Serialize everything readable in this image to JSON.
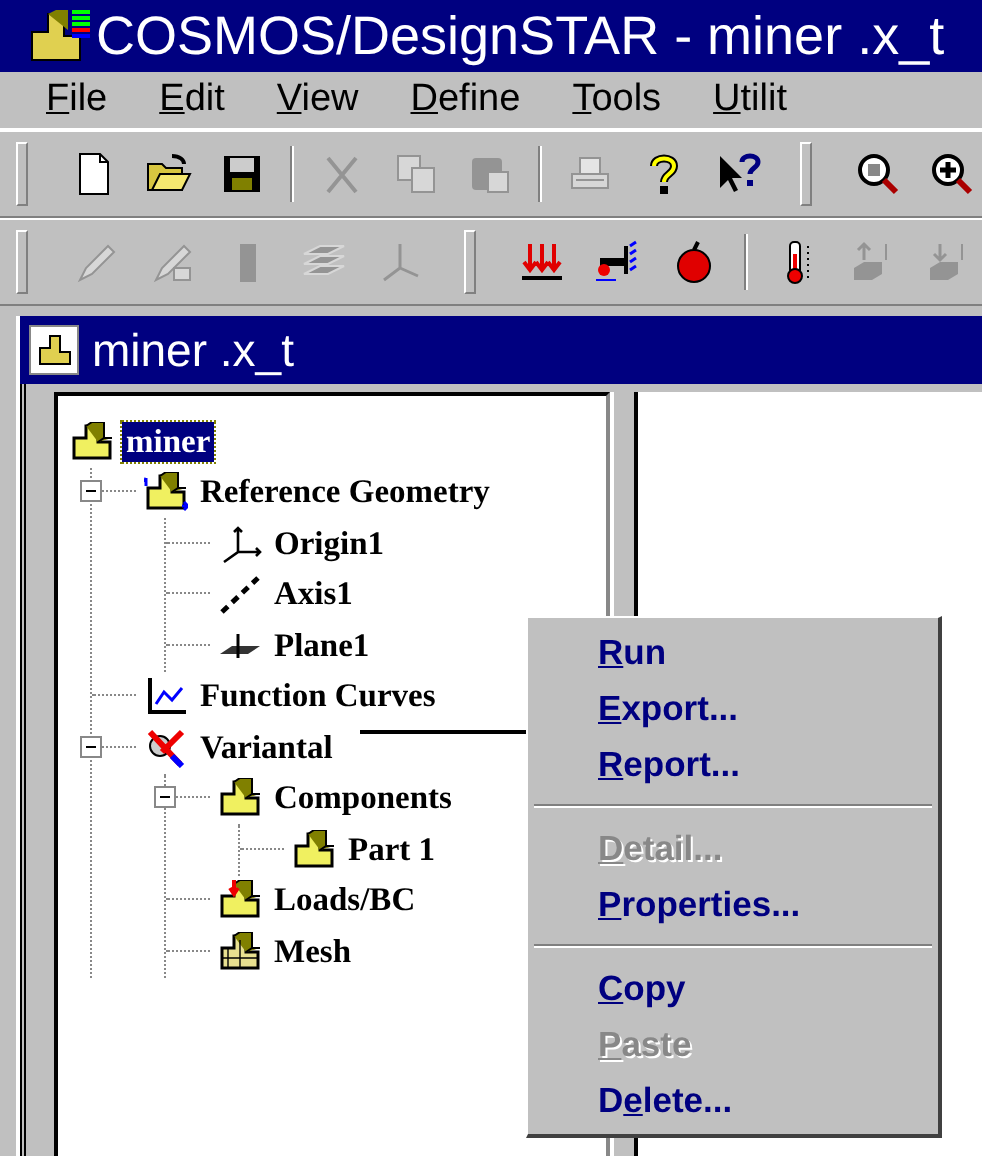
{
  "window": {
    "title": "COSMOS/DesignSTAR - miner .x_t"
  },
  "menu_bar": [
    {
      "key": "F",
      "rest": "ile"
    },
    {
      "key": "E",
      "rest": "dit"
    },
    {
      "key": "V",
      "rest": "iew"
    },
    {
      "key": "D",
      "rest": "efine"
    },
    {
      "key": "T",
      "rest": "ools"
    },
    {
      "key": "U",
      "rest": "tilit"
    }
  ],
  "toolbars": [
    {
      "items": [
        {
          "kind": "new-file",
          "disabled": false
        },
        {
          "kind": "open-folder",
          "disabled": false
        },
        {
          "kind": "save",
          "disabled": false
        },
        {
          "kind": "separator"
        },
        {
          "kind": "cut",
          "disabled": true
        },
        {
          "kind": "copy",
          "disabled": true
        },
        {
          "kind": "paste",
          "disabled": true
        },
        {
          "kind": "separator"
        },
        {
          "kind": "print",
          "disabled": true
        },
        {
          "kind": "help",
          "disabled": false
        },
        {
          "kind": "context-help",
          "disabled": false
        },
        {
          "kind": "grip"
        },
        {
          "kind": "zoom-box",
          "disabled": false
        },
        {
          "kind": "zoom-in",
          "disabled": false
        }
      ]
    },
    {
      "items": [
        {
          "kind": "pen",
          "disabled": true
        },
        {
          "kind": "pen-edit",
          "disabled": true
        },
        {
          "kind": "bar",
          "disabled": true
        },
        {
          "kind": "layers",
          "disabled": true
        },
        {
          "kind": "axes",
          "disabled": true
        },
        {
          "kind": "grip"
        },
        {
          "kind": "loads",
          "disabled": false
        },
        {
          "kind": "restraint",
          "disabled": false
        },
        {
          "kind": "gravity",
          "disabled": false
        },
        {
          "kind": "separator"
        },
        {
          "kind": "thermometer",
          "disabled": false
        },
        {
          "kind": "heat-up",
          "disabled": true
        },
        {
          "kind": "heat-down",
          "disabled": true
        }
      ]
    }
  ],
  "document": {
    "title": "miner .x_t",
    "tree": [
      {
        "label": "miner",
        "kind": "part",
        "selected": true,
        "children": [
          {
            "label": "Reference Geometry",
            "kind": "ref-geometry",
            "selected": false,
            "expanded": true,
            "children": [
              {
                "label": "Origin1",
                "kind": "origin",
                "selected": false
              },
              {
                "label": "Axis1",
                "kind": "axis",
                "selected": false
              },
              {
                "label": "Plane1",
                "kind": "plane",
                "selected": false
              }
            ]
          },
          {
            "label": "Function Curves",
            "kind": "curves",
            "selected": false
          },
          {
            "label": "Variantal",
            "kind": "study",
            "selected": false,
            "expanded": true,
            "children": [
              {
                "label": "Components",
                "kind": "part",
                "selected": false,
                "expanded": true,
                "children": [
                  {
                    "label": "Part 1",
                    "kind": "part",
                    "selected": false
                  }
                ]
              },
              {
                "label": "Loads/BC",
                "kind": "loads-part",
                "selected": false
              },
              {
                "label": "Mesh",
                "kind": "mesh-part",
                "selected": false
              }
            ]
          }
        ]
      }
    ]
  },
  "context_menu": {
    "sections": [
      {
        "items": [
          {
            "key": "R",
            "rest": "un",
            "disabled": false
          },
          {
            "key": "E",
            "rest": "xport...",
            "disabled": false
          },
          {
            "key": "R",
            "rest": "eport...",
            "disabled": false
          }
        ]
      },
      {
        "items": [
          {
            "key": "D",
            "rest": "etail...",
            "disabled": true
          },
          {
            "key": "P",
            "rest": "roperties...",
            "disabled": false
          }
        ]
      },
      {
        "items": [
          {
            "key": "C",
            "rest": "opy",
            "disabled": false
          },
          {
            "key": "P",
            "rest": "aste",
            "disabled": true
          },
          {
            "lead": "D",
            "key": "e",
            "rest": "lete...",
            "disabled": false
          }
        ]
      }
    ]
  }
}
